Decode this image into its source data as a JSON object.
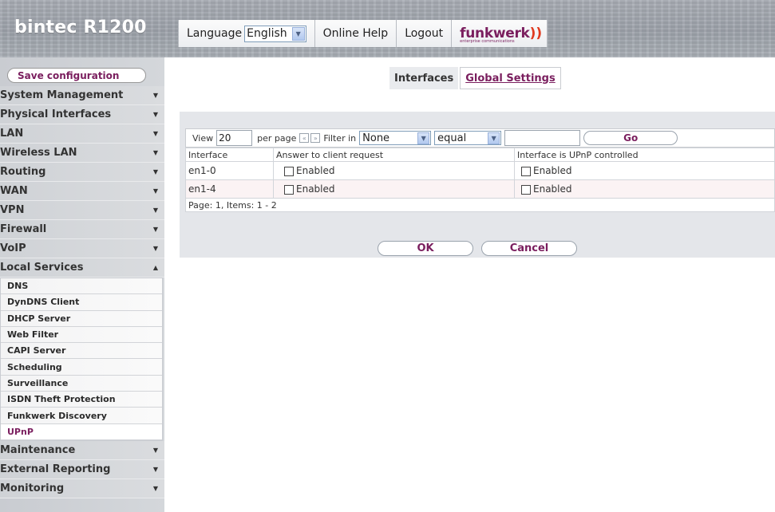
{
  "header": {
    "brand": "bintec R1200",
    "language_label": "Language",
    "language_value": "English",
    "online_help": "Online Help",
    "logout": "Logout",
    "logo_text": "funkwerk",
    "logo_sub": "enterprise communications"
  },
  "sidebar": {
    "save_label": "Save configuration",
    "items": [
      {
        "label": "System Management"
      },
      {
        "label": "Physical Interfaces"
      },
      {
        "label": "LAN"
      },
      {
        "label": "Wireless LAN"
      },
      {
        "label": "Routing"
      },
      {
        "label": "WAN"
      },
      {
        "label": "VPN"
      },
      {
        "label": "Firewall"
      },
      {
        "label": "VoIP"
      },
      {
        "label": "Local Services"
      }
    ],
    "sub_items": [
      {
        "label": "DNS"
      },
      {
        "label": "DynDNS Client"
      },
      {
        "label": "DHCP Server"
      },
      {
        "label": "Web Filter"
      },
      {
        "label": "CAPI Server"
      },
      {
        "label": "Scheduling"
      },
      {
        "label": "Surveillance"
      },
      {
        "label": "ISDN Theft Protection"
      },
      {
        "label": "Funkwerk Discovery"
      },
      {
        "label": "UPnP"
      }
    ],
    "items_after": [
      {
        "label": "Maintenance"
      },
      {
        "label": "External Reporting"
      },
      {
        "label": "Monitoring"
      }
    ]
  },
  "tabs": {
    "active": "Interfaces",
    "other": "Global Settings"
  },
  "toolbar": {
    "view_label": "View",
    "view_value": "20",
    "per_page": "per page",
    "prev_icon": "«",
    "next_icon": "»",
    "filter_in": "Filter in",
    "filter_field": "None",
    "filter_op": "equal",
    "go": "Go"
  },
  "table": {
    "columns": [
      "Interface",
      "Answer to client request",
      "Interface is UPnP controlled"
    ],
    "rows": [
      {
        "interface": "en1-0",
        "answer": "Enabled",
        "controlled": "Enabled"
      },
      {
        "interface": "en1-4",
        "answer": "Enabled",
        "controlled": "Enabled"
      }
    ],
    "footer": "Page: 1, Items: 1 - 2"
  },
  "actions": {
    "ok": "OK",
    "cancel": "Cancel"
  },
  "colors": {
    "accent": "#7a1e5e",
    "sidebar_bg": "#d4d7db",
    "panel_bg": "#e4e6ea"
  }
}
